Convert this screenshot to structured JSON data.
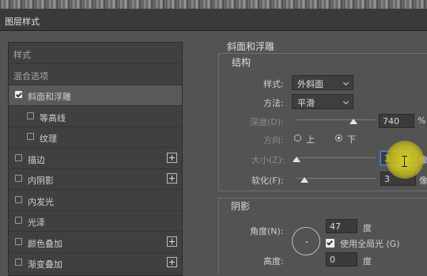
{
  "window": {
    "title": "图层样式"
  },
  "styles_list": [
    {
      "label": "样式",
      "type": "heading"
    },
    {
      "label": "混合选项",
      "type": "heading"
    },
    {
      "label": "斜面和浮雕",
      "checked": true,
      "selected": true,
      "indent": false,
      "plus": false
    },
    {
      "label": "等高线",
      "checked": false,
      "indent": true,
      "plus": false
    },
    {
      "label": "纹理",
      "checked": false,
      "indent": true,
      "plus": false
    },
    {
      "label": "描边",
      "checked": false,
      "indent": false,
      "plus": true
    },
    {
      "label": "内阴影",
      "checked": false,
      "indent": false,
      "plus": true
    },
    {
      "label": "内发光",
      "checked": false,
      "indent": false,
      "plus": false
    },
    {
      "label": "光泽",
      "checked": false,
      "indent": false,
      "plus": false
    },
    {
      "label": "颜色叠加",
      "checked": false,
      "indent": false,
      "plus": true
    },
    {
      "label": "渐变叠加",
      "checked": false,
      "indent": false,
      "plus": true
    }
  ],
  "bevel": {
    "section_title": "斜面和浮雕",
    "structure_title": "结构",
    "style": {
      "label": "样式:",
      "value": "外斜面"
    },
    "technique": {
      "label": "方法:",
      "value": "平滑"
    },
    "depth": {
      "label": "深度(D):",
      "value": "740",
      "unit": "%",
      "level": 0.72
    },
    "direction": {
      "label": "方向:",
      "up": "上",
      "down": "下",
      "selected": "下"
    },
    "size": {
      "label": "大小(Z):",
      "value": "3",
      "unit": "像",
      "level": 0.0
    },
    "soften": {
      "label": "软化(F):",
      "value": "3",
      "unit": "像",
      "level": 0.1
    }
  },
  "shading": {
    "title": "阴影",
    "angle": {
      "label": "角度(N):",
      "value": "47",
      "unit": "度"
    },
    "global_light": {
      "label": "使用全局光 (G)",
      "checked": true
    },
    "altitude": {
      "label": "高度:",
      "value": "0",
      "unit": "度"
    }
  }
}
